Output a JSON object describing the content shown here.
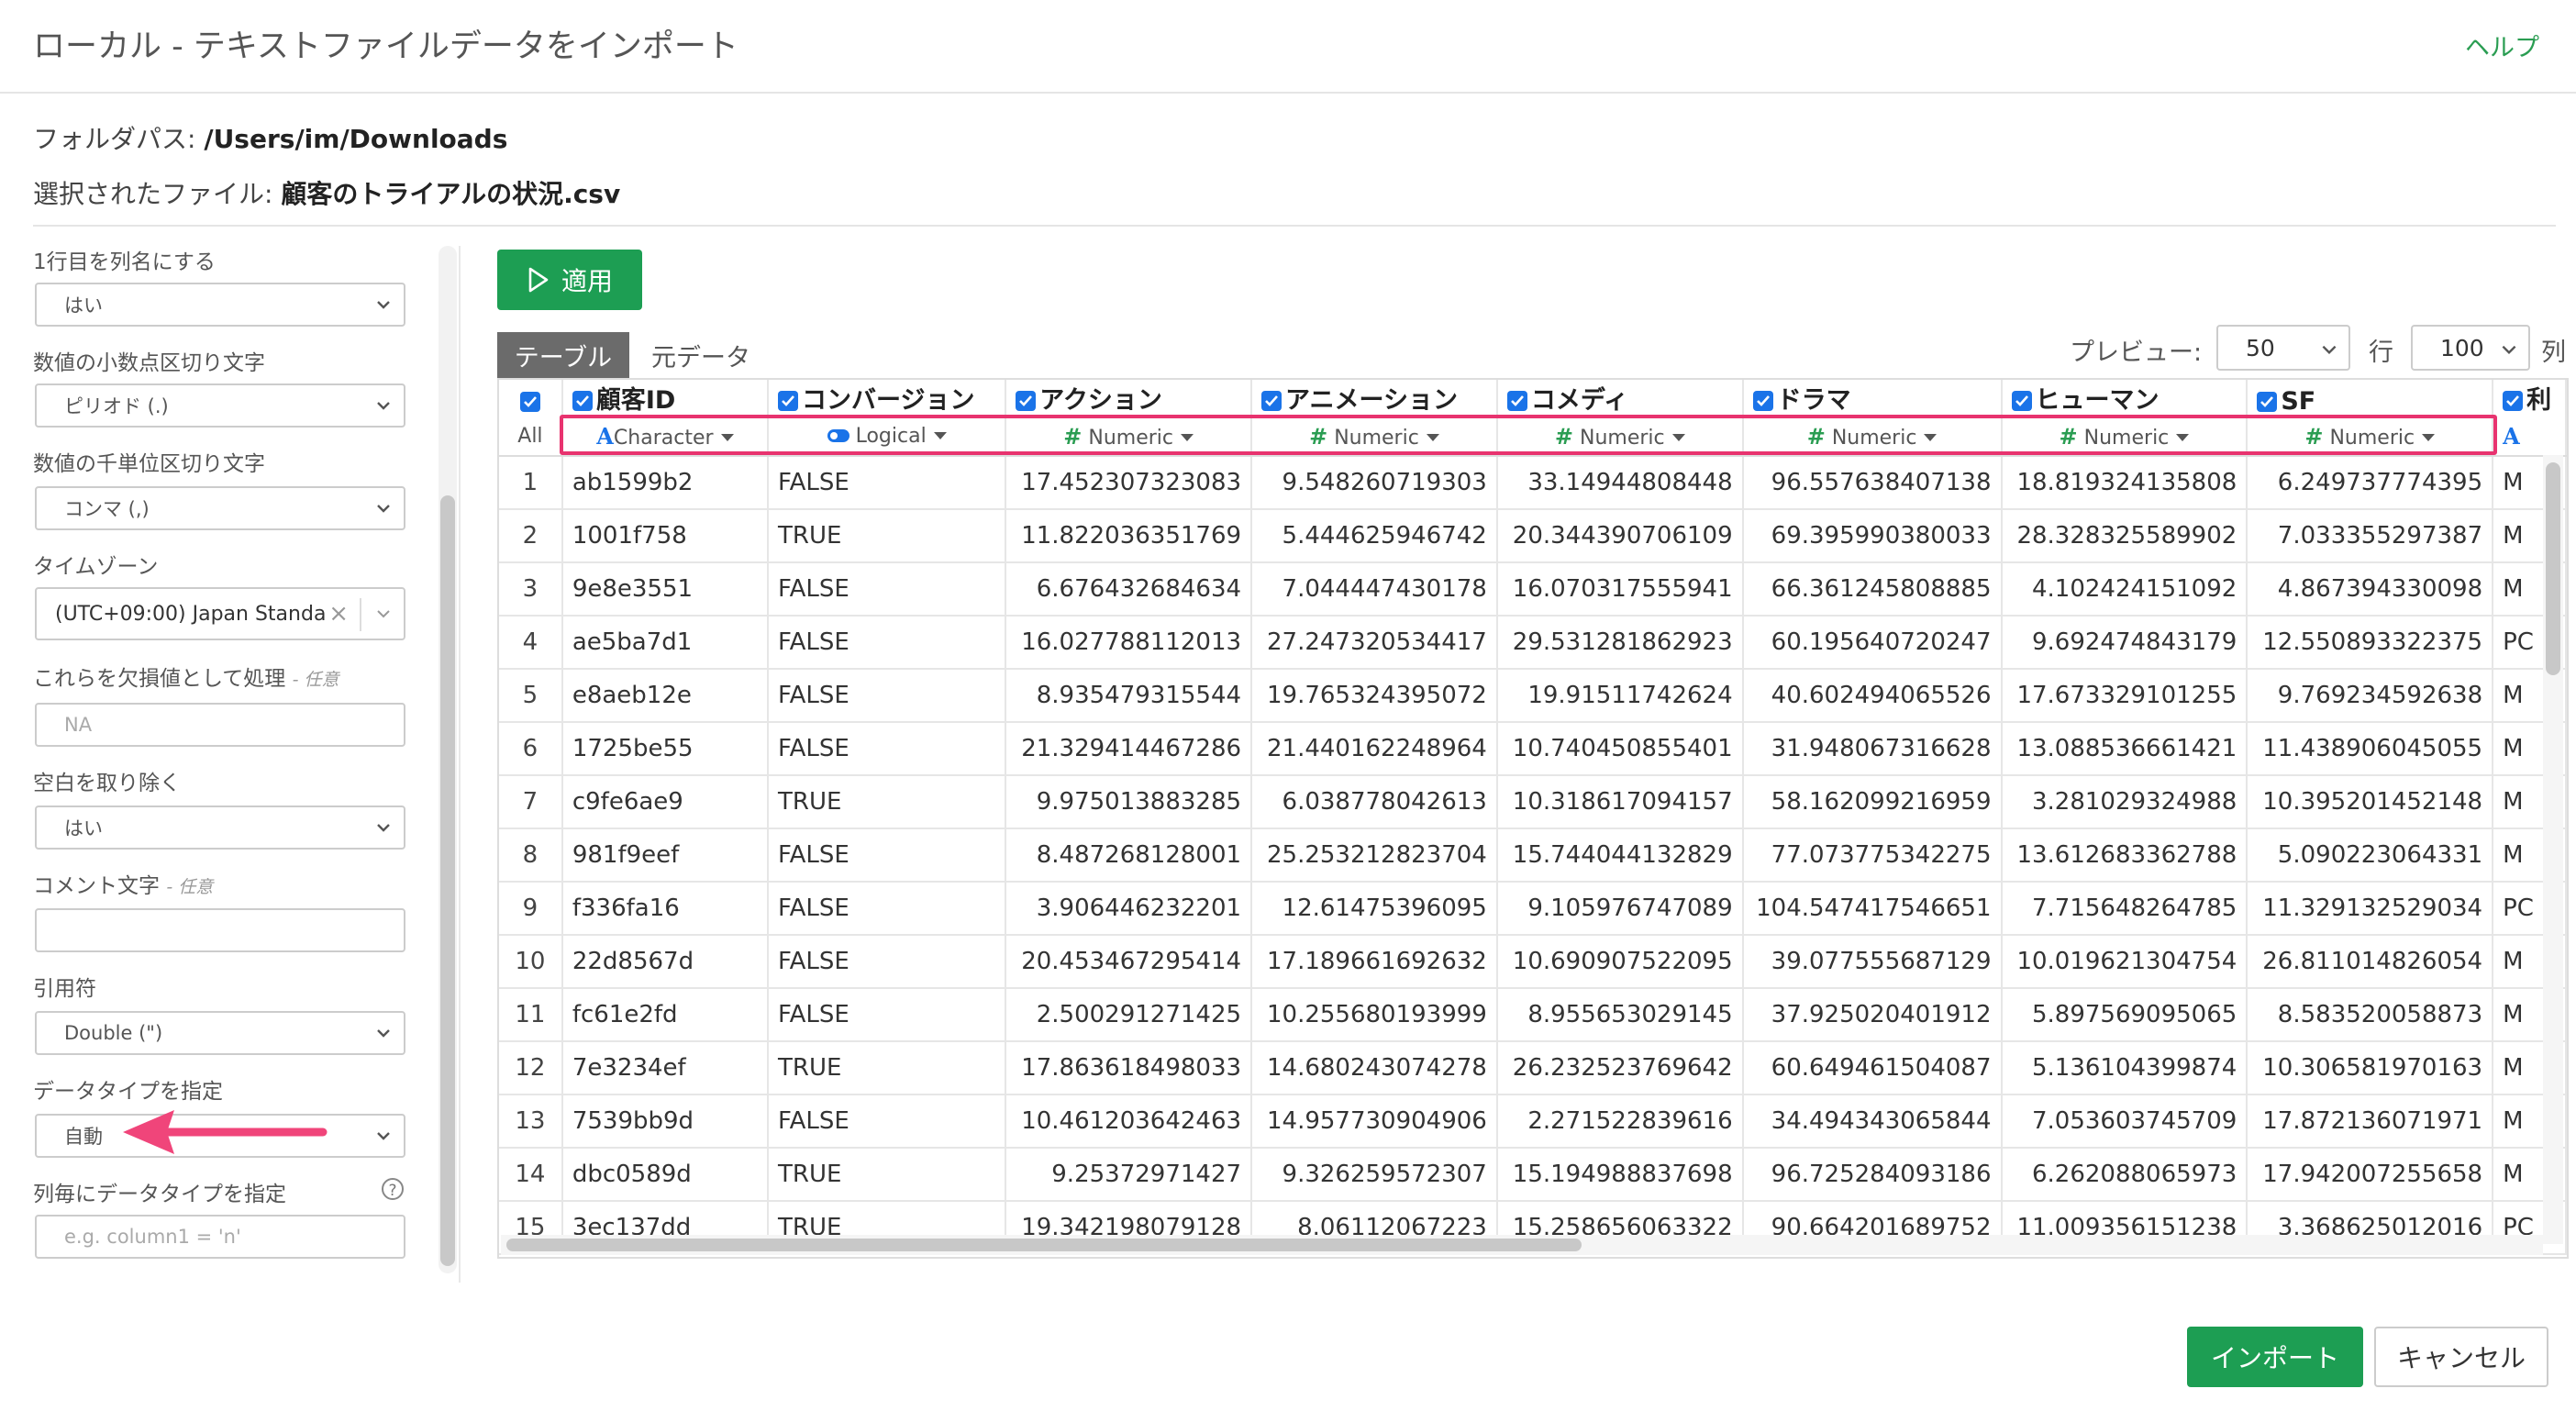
{
  "header": {
    "title": "ローカル - テキストファイルデータをインポート",
    "help": "ヘルプ"
  },
  "folder": {
    "label": "フォルダパス: ",
    "value": "/Users/im/Downloads"
  },
  "file": {
    "label": "選択されたファイル: ",
    "value": "顧客のトライアルの状況.csv"
  },
  "sidebar": {
    "header_row": {
      "label": "1行目を列名にする",
      "value": "はい"
    },
    "decimal": {
      "label": "数値の小数点区切り文字",
      "value": "ピリオド (.)"
    },
    "thousands": {
      "label": "数値の千単位区切り文字",
      "value": "コンマ (,)"
    },
    "timezone": {
      "label": "タイムゾーン",
      "value": "(UTC+09:00) Japan Standa",
      "clear": "×"
    },
    "na": {
      "label": "これらを欠損値として処理",
      "optional": "- 任意",
      "placeholder": "NA"
    },
    "trim": {
      "label": "空白を取り除く",
      "value": "はい"
    },
    "comment": {
      "label": "コメント文字",
      "optional": "- 任意"
    },
    "quote": {
      "label": "引用符",
      "value": "Double (\")"
    },
    "datatype": {
      "label": "データタイプを指定",
      "value": "自動"
    },
    "col_types": {
      "label": "列毎にデータタイプを指定",
      "help": "?",
      "placeholder": "e.g. column1 = 'n'"
    }
  },
  "toolbar": {
    "apply": "適用",
    "tabs": [
      "テーブル",
      "元データ"
    ],
    "preview_label": "プレビュー:",
    "preview_rows": "50",
    "rows_unit": "行",
    "preview_cols": "100",
    "cols_unit": "列"
  },
  "table": {
    "all_label": "All",
    "columns": [
      {
        "name": "顧客ID",
        "type": "Character",
        "kind": "char"
      },
      {
        "name": "コンバージョン",
        "type": "Logical",
        "kind": "logical"
      },
      {
        "name": "アクション",
        "type": "Numeric",
        "kind": "num"
      },
      {
        "name": "アニメーション",
        "type": "Numeric",
        "kind": "num"
      },
      {
        "name": "コメディ",
        "type": "Numeric",
        "kind": "num"
      },
      {
        "name": "ドラマ",
        "type": "Numeric",
        "kind": "num"
      },
      {
        "name": "ヒューマン",
        "type": "Numeric",
        "kind": "num"
      },
      {
        "name": "SF",
        "type": "Numeric",
        "kind": "num"
      },
      {
        "name": "利",
        "type": "",
        "kind": "char"
      }
    ],
    "rows": [
      [
        "1",
        "ab1599b2",
        "FALSE",
        "17.452307323083",
        "9.548260719303",
        "33.14944808448",
        "96.557638407138",
        "18.819324135808",
        "6.249737774395",
        "M"
      ],
      [
        "2",
        "1001f758",
        "TRUE",
        "11.822036351769",
        "5.444625946742",
        "20.344390706109",
        "69.395990380033",
        "28.328325589902",
        "7.033355297387",
        "M"
      ],
      [
        "3",
        "9e8e3551",
        "FALSE",
        "6.676432684634",
        "7.044447430178",
        "16.070317555941",
        "66.361245808885",
        "4.102424151092",
        "4.867394330098",
        "M"
      ],
      [
        "4",
        "ae5ba7d1",
        "FALSE",
        "16.027788112013",
        "27.247320534417",
        "29.531281862923",
        "60.195640720247",
        "9.692474843179",
        "12.550893322375",
        "PC"
      ],
      [
        "5",
        "e8aeb12e",
        "FALSE",
        "8.935479315544",
        "19.765324395072",
        "19.91511742624",
        "40.602494065526",
        "17.673329101255",
        "9.769234592638",
        "M"
      ],
      [
        "6",
        "1725be55",
        "FALSE",
        "21.329414467286",
        "21.440162248964",
        "10.740450855401",
        "31.948067316628",
        "13.088536661421",
        "11.438906045055",
        "M"
      ],
      [
        "7",
        "c9fe6ae9",
        "TRUE",
        "9.975013883285",
        "6.038778042613",
        "10.318617094157",
        "58.162099216959",
        "3.281029324988",
        "10.395201452148",
        "M"
      ],
      [
        "8",
        "981f9eef",
        "FALSE",
        "8.487268128001",
        "25.253212823704",
        "15.744044132829",
        "77.073775342275",
        "13.612683362788",
        "5.090223064331",
        "M"
      ],
      [
        "9",
        "f336fa16",
        "FALSE",
        "3.906446232201",
        "12.61475396095",
        "9.105976747089",
        "104.547417546651",
        "7.715648264785",
        "11.329132529034",
        "PC"
      ],
      [
        "10",
        "22d8567d",
        "FALSE",
        "20.453467295414",
        "17.189661692632",
        "10.690907522095",
        "39.077555687129",
        "10.019621304754",
        "26.811014826054",
        "M"
      ],
      [
        "11",
        "fc61e2fd",
        "FALSE",
        "2.500291271425",
        "10.255680193999",
        "8.955653029145",
        "37.925020401912",
        "5.897569095065",
        "8.583520058873",
        "M"
      ],
      [
        "12",
        "7e3234ef",
        "TRUE",
        "17.863618498033",
        "14.680243074278",
        "26.232523769642",
        "60.649461504087",
        "5.136104399874",
        "10.306581970163",
        "M"
      ],
      [
        "13",
        "7539bb9d",
        "FALSE",
        "10.461203642463",
        "14.957730904906",
        "2.271522839616",
        "34.494343065844",
        "7.053603745709",
        "17.872136071971",
        "M"
      ],
      [
        "14",
        "dbc0589d",
        "TRUE",
        "9.25372971427",
        "9.326259572307",
        "15.194988837698",
        "96.725284093186",
        "6.262088065973",
        "17.942007255658",
        "M"
      ],
      [
        "15",
        "3ec137dd",
        "TRUE",
        "19.342198079128",
        "8.06112067223",
        "15.258656063322",
        "90.664201689752",
        "11.009356151238",
        "3.368625012016",
        "PC"
      ]
    ]
  },
  "footer": {
    "import": "インポート",
    "cancel": "キャンセル"
  },
  "colors": {
    "accent_green": "#1d9e53",
    "highlight": "#e8336f",
    "checkbox_blue": "#1a73e8"
  }
}
